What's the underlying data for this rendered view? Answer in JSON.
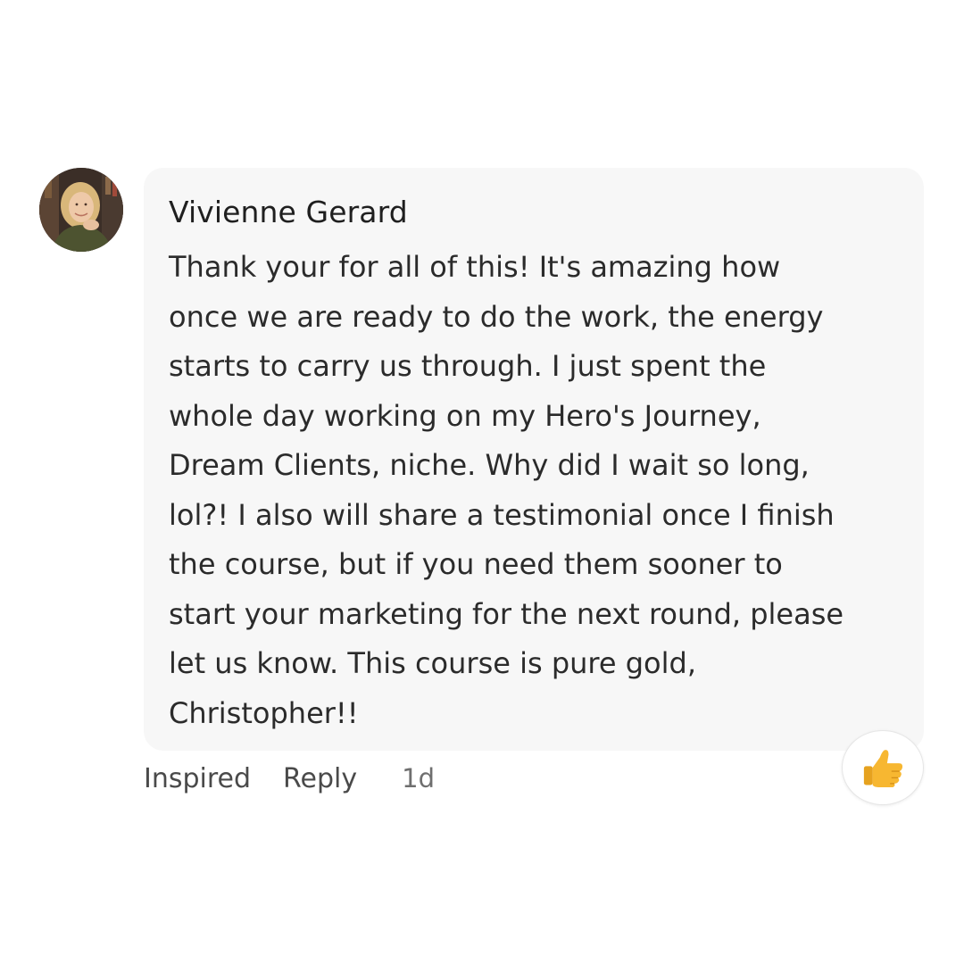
{
  "comment": {
    "author": "Vivienne Gerard",
    "avatar_icon": "profile-photo",
    "text_lines": [
      "Thank your for all of this! It's amazing how",
      "once we are ready to do the work, the energy",
      "starts to carry us through. I just spent the",
      "whole day working on my Hero's Journey,",
      "Dream Clients, niche. Why did I wait so long,",
      "lol?! I also will share a testimonial once I finish",
      "the course, but if you need them sooner to",
      "start your marketing for the next round, please",
      "let us know. This course is pure gold,",
      "Christopher!!"
    ],
    "bubble_color": "#f7f7f7"
  },
  "actions": {
    "reaction_label": "Inspired",
    "reply_label": "Reply",
    "timestamp": "1d"
  },
  "reaction_badge": {
    "icon": "thumbs-up-icon",
    "color": "#f7b731"
  }
}
